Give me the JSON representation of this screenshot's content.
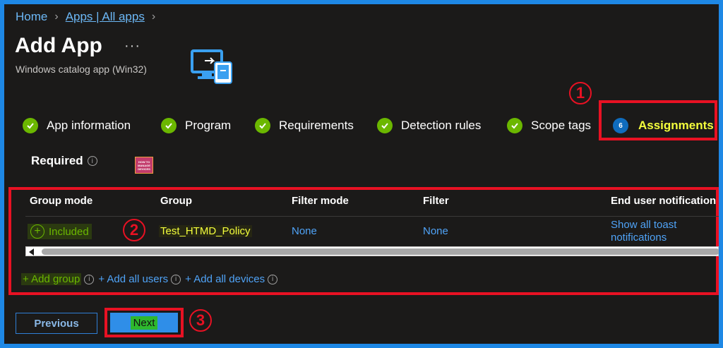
{
  "breadcrumb": {
    "home": "Home",
    "apps": "Apps | All apps"
  },
  "header": {
    "title": "Add App",
    "more": "···",
    "subtitle": "Windows catalog app (Win32)"
  },
  "steps": [
    {
      "label": "App information",
      "state": "complete"
    },
    {
      "label": "Program",
      "state": "complete"
    },
    {
      "label": "Requirements",
      "state": "complete"
    },
    {
      "label": "Detection rules",
      "state": "complete"
    },
    {
      "label": "Scope tags",
      "state": "complete"
    },
    {
      "label": "Assignments",
      "state": "active",
      "number": "6"
    }
  ],
  "callouts": [
    "1",
    "2",
    "3"
  ],
  "section": {
    "required_label": "Required",
    "info": "i",
    "logo_text": [
      "HOW TO",
      "MANAGE",
      "DEVICES"
    ]
  },
  "table": {
    "columns": [
      "Group mode",
      "Group",
      "Filter mode",
      "Filter",
      "End user notification"
    ],
    "rows": [
      {
        "group_mode": "Included",
        "group": "Test_HTMD_Policy",
        "filter_mode": "None",
        "filter": "None",
        "notification_line1": "Show all toast",
        "notification_line2": "notifications"
      }
    ]
  },
  "actions": {
    "add_group": "+ Add group",
    "add_all_users": "+ Add all users",
    "add_all_devices": "+ Add all devices"
  },
  "footer": {
    "previous": "Previous",
    "next": "Next"
  },
  "colors": {
    "accent": "#0f6cbd",
    "success": "#6bb700",
    "highlight_box": "#e81123",
    "highlight_text": "#f4ff3c"
  }
}
